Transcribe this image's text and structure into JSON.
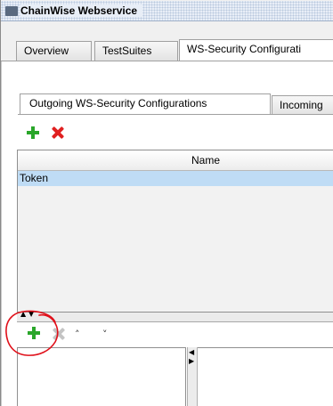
{
  "window": {
    "title": "ChainWise Webservice"
  },
  "tabs": [
    {
      "label": "Overview",
      "active": false
    },
    {
      "label": "TestSuites",
      "active": false
    },
    {
      "label": "WS-Security Configurati",
      "active": true
    }
  ],
  "sub_tabs": [
    {
      "label": "Outgoing WS-Security Configurations",
      "active": true
    },
    {
      "label": "Incoming",
      "active": false
    }
  ],
  "toolbar_top": {
    "add_icon": "plus-icon",
    "remove_icon": "remove-icon"
  },
  "table": {
    "columns": [
      "Name"
    ],
    "rows": [
      {
        "name": "Token",
        "selected": true
      }
    ]
  },
  "toolbar_bottom": {
    "add_icon": "plus-icon",
    "remove_icon": "remove-icon",
    "remove_disabled": true,
    "move_up_icon": "chevron-up-icon",
    "move_down_icon": "chevron-down-icon"
  },
  "colors": {
    "add_green": "#2aa62a",
    "remove_red": "#e02020",
    "selection_blue": "#bfdcf5",
    "annotation_red": "#e0101a"
  }
}
